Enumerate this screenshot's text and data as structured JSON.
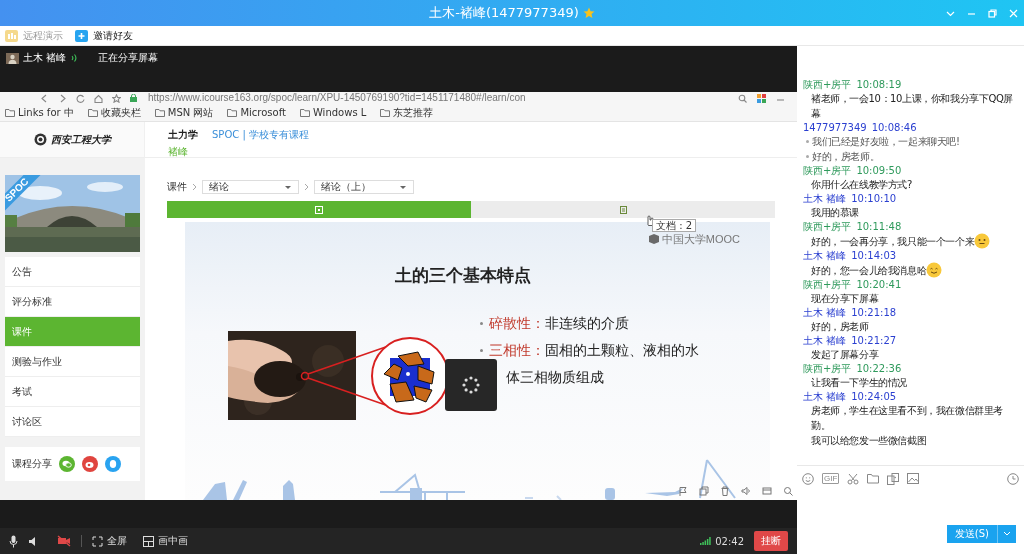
{
  "window": {
    "title": "土木-褚峰(1477977349)",
    "starred": true
  },
  "toolbar": [
    {
      "label": "远程演示",
      "disabled": true
    },
    {
      "label": "邀请好友",
      "disabled": false
    }
  ],
  "share_header": {
    "user": "土木 褚峰",
    "status": "正在分享屏幕"
  },
  "browser": {
    "url": "https://www.icourse163.org/spoc/learn/XPU-1450769190?tid=1451171480#/learn/con",
    "bookmarks": [
      "Links for 中",
      "收藏夹栏",
      "MSN 网站",
      "Microsoft",
      "Windows L",
      "东芝推荐"
    ]
  },
  "course_site": {
    "logo_text": "西安工程大学",
    "course": "土力学",
    "course_type": "SPOC | 学校专有课程",
    "teacher": "褚峰",
    "cover_badge": "SPOC",
    "menu": [
      {
        "label": "公告",
        "selected": false
      },
      {
        "label": "评分标准",
        "selected": false
      },
      {
        "label": "课件",
        "selected": true
      },
      {
        "label": "测验与作业",
        "selected": false
      },
      {
        "label": "考试",
        "selected": false
      },
      {
        "label": "讨论区",
        "selected": false
      }
    ],
    "share_label": "课程分享",
    "breadcrumb": {
      "root": "课件",
      "chapter": "绪论",
      "section": "绪论（上）"
    },
    "content_tabs": [
      {
        "selected": true
      },
      {
        "selected": false
      }
    ],
    "tooltip": "文档 : 2"
  },
  "slide": {
    "brand": "中国大学MOOC",
    "title": "土的三个基本特点",
    "loading": true,
    "bullets": [
      {
        "term": "碎散性：",
        "lines": [
          "非连续的介质"
        ]
      },
      {
        "term": "三相性：",
        "lines": [
          "固相的土颗粒、液相的水",
          "体三相物质组成"
        ]
      }
    ]
  },
  "call": {
    "camera_off": true,
    "fullscreen": "全屏",
    "pip": "画中画",
    "duration": "02:42",
    "hangup": "挂断"
  },
  "chat": {
    "messages": [
      {
        "sender": "陕西+房平",
        "time": "10:08:19",
        "color": "#2f9a5c",
        "kind": "text",
        "lines": [
          "褚老师，一会10：10上课，你和我分享下QQ屏幕"
        ]
      },
      {
        "sender": "1477977349",
        "time": "10:08:46",
        "color": "#2a3fd0",
        "kind": "notice",
        "lines": [
          "我们已经是好友啦，一起来聊天吧!",
          "好的，房老师。"
        ]
      },
      {
        "sender": "陕西+房平",
        "time": "10:09:50",
        "color": "#2f9a5c",
        "kind": "text",
        "lines": [
          "你用什么在线教学方式?"
        ]
      },
      {
        "sender": "土木 褚峰",
        "time": "10:10:10",
        "color": "#2a3fd0",
        "kind": "text",
        "lines": [
          "我用的慕课"
        ]
      },
      {
        "sender": "陕西+房平",
        "time": "10:11:48",
        "color": "#2f9a5c",
        "kind": "text",
        "lines": [
          "好的，一会再分享，我只能一个一个来"
        ],
        "emoji": {
          "kind": "neutral"
        }
      },
      {
        "sender": "土木 褚峰",
        "time": "10:14:03",
        "color": "#2a3fd0",
        "kind": "text",
        "lines": [
          "好的，您一会儿给我消息哈"
        ],
        "emoji": {
          "kind": "smile"
        }
      },
      {
        "sender": "陕西+房平",
        "time": "10:20:41",
        "color": "#2f9a5c",
        "kind": "text",
        "lines": [
          "现在分享下屏幕"
        ]
      },
      {
        "sender": "土木 褚峰",
        "time": "10:21:18",
        "color": "#2a3fd0",
        "kind": "text",
        "lines": [
          "好的，房老师"
        ]
      },
      {
        "sender": "土木 褚峰",
        "time": "10:21:27",
        "color": "#2a3fd0",
        "kind": "text",
        "lines": [
          "发起了屏幕分享"
        ]
      },
      {
        "sender": "陕西+房平",
        "time": "10:22:36",
        "color": "#2f9a5c",
        "kind": "text",
        "lines": [
          "让我看一下学生的情况"
        ]
      },
      {
        "sender": "土木 褚峰",
        "time": "10:24:05",
        "color": "#2a3fd0",
        "kind": "text",
        "lines": [
          "房老师，学生在这里看不到，我在微信群里考勤。",
          "我可以给您发一些微信截图"
        ]
      }
    ],
    "gif_label": "GIF",
    "send": "发送(S)"
  }
}
